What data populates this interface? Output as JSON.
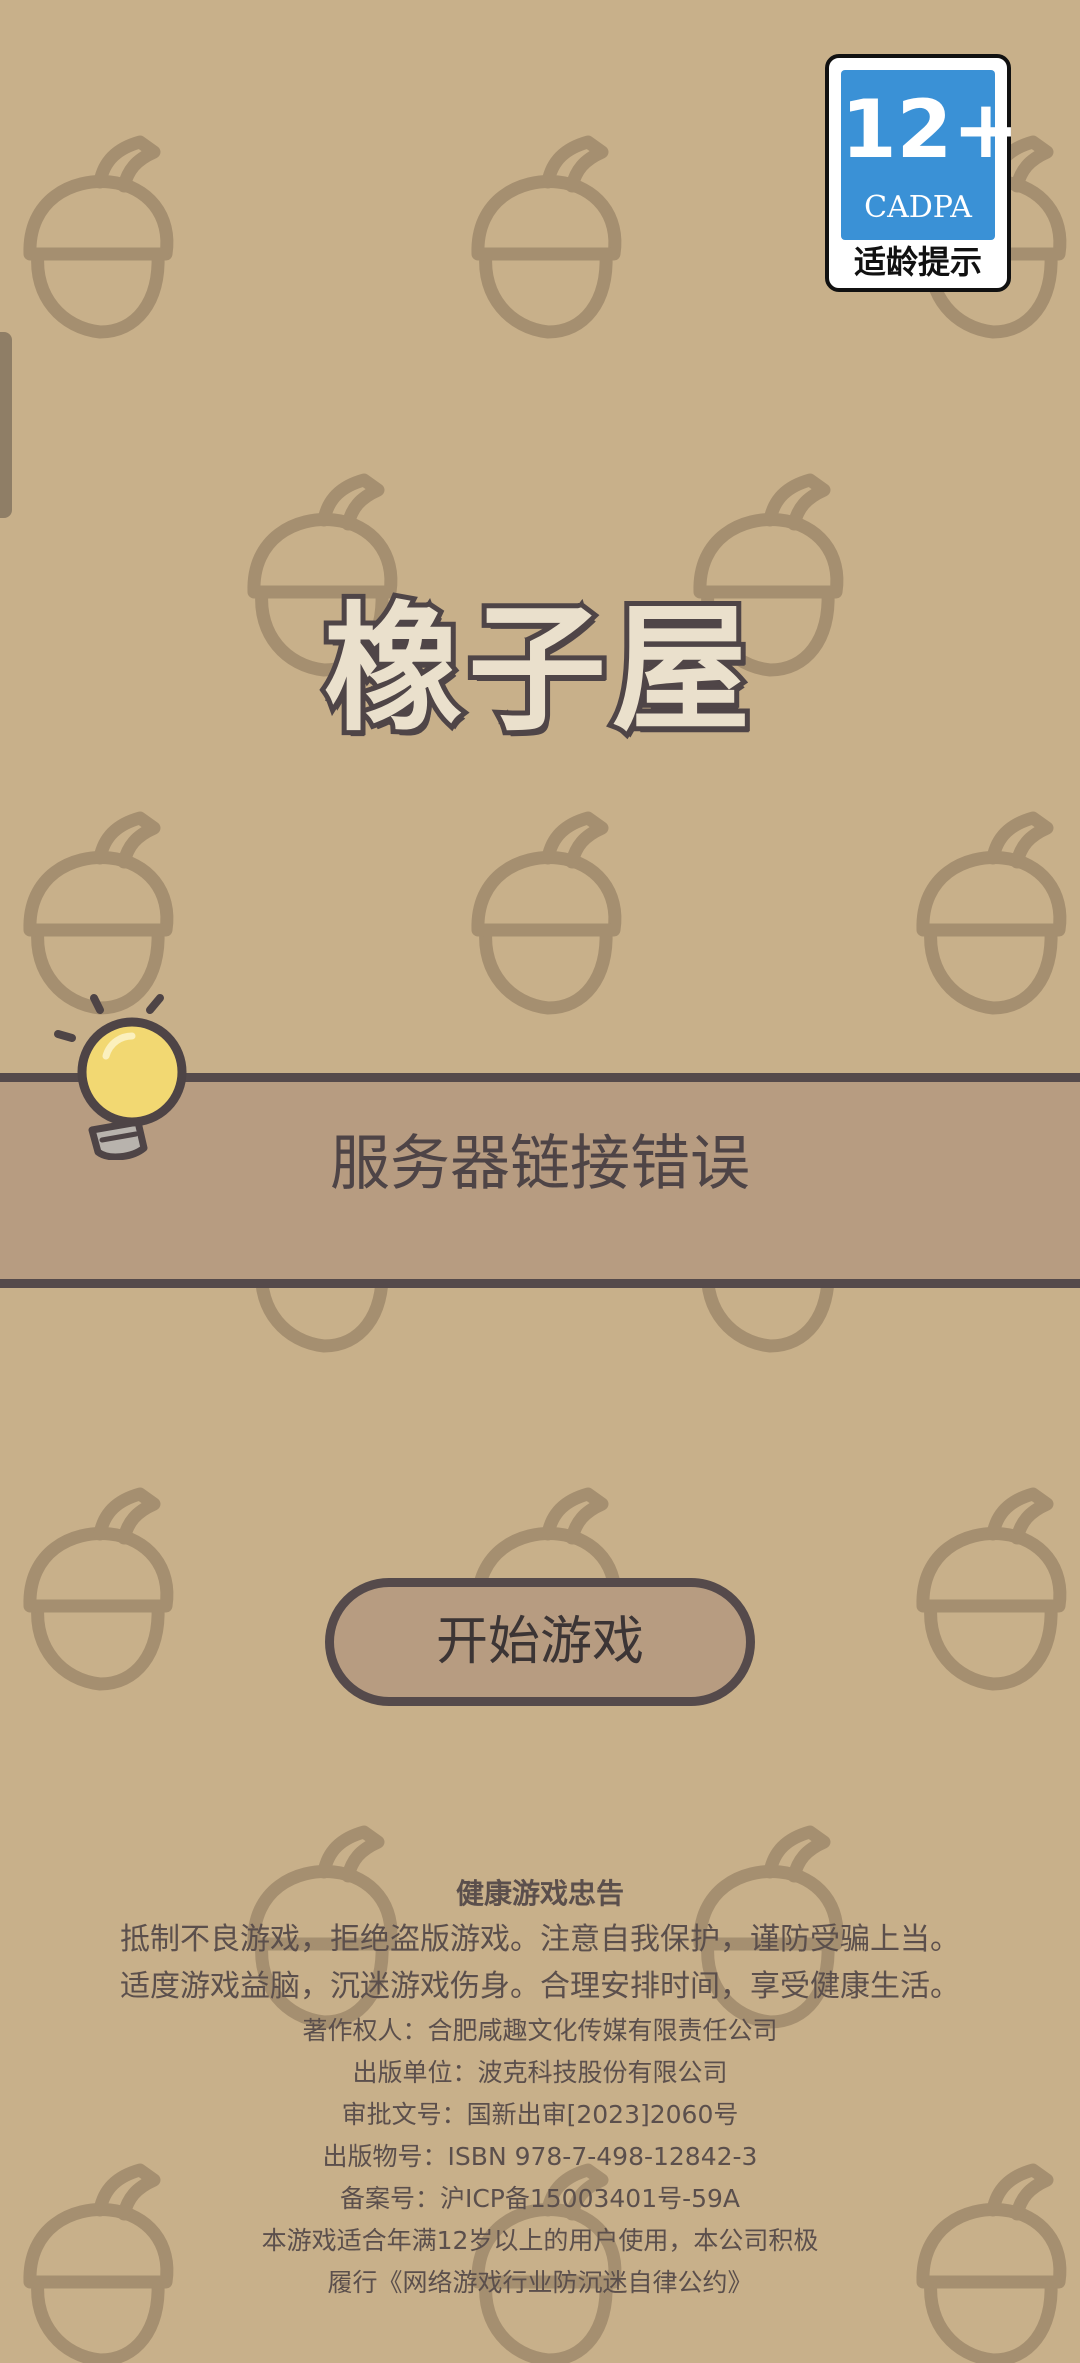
{
  "app": {
    "title": "橡子屋"
  },
  "age_rating": {
    "rating": "12+",
    "org": "CADPA",
    "caption": "适龄提示",
    "color": "#3a91d6"
  },
  "status": {
    "message": "服务器链接错误",
    "icon": "lightbulb-icon"
  },
  "actions": {
    "start_label": "开始游戏"
  },
  "footer": {
    "title": "健康游戏忠告",
    "advice_line1": "抵制不良游戏，拒绝盗版游戏。注意自我保护，谨防受骗上当。",
    "advice_line2": "适度游戏益脑，沉迷游戏伤身。合理安排时间，享受健康生活。",
    "copyright": "著作权人：合肥咸趣文化传媒有限责任公司",
    "publisher": "出版单位：波克科技股份有限公司",
    "approval": "审批文号：国新出审[2023]2060号",
    "isbn": "出版物号：ISBN 978-7-498-12842-3",
    "icp": "备案号：沪ICP备15003401号-59A",
    "age_notice_line1": "本游戏适合年满12岁以上的用户使用，本公司积极",
    "age_notice_line2": "履行《网络游戏行业防沉迷自律公约》"
  },
  "theme": {
    "background": "#c8b08a",
    "banner": "#b79c81",
    "outline": "#554a4b",
    "text": "#4e4446",
    "bulb": "#f2d872"
  }
}
